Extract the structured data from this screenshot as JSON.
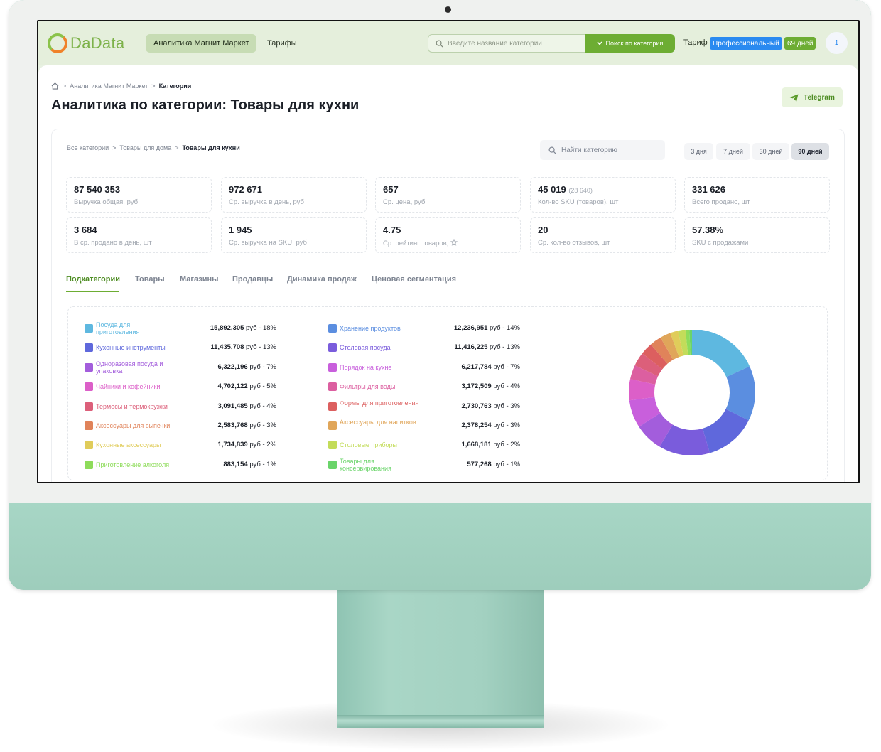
{
  "header": {
    "logo_text": "DaData",
    "nav_active": "Аналитика Магнит Маркет",
    "nav_link": "Тарифы",
    "search_placeholder": "Введите название категории",
    "search_button": "Поиск по категории",
    "tariff_label": "Тариф",
    "tariff_name": "Профессиональный",
    "tariff_days": "69 дней",
    "avatar": "1"
  },
  "breadcrumb": [
    "Аналитика Магнит Маркет",
    "Категории"
  ],
  "page_title": "Аналитика по категории: Товары для кухни",
  "telegram_button": "Telegram",
  "category_path": [
    "Все категории",
    "Товары для дома",
    "Товары для кухни"
  ],
  "find_placeholder": "Найти категорию",
  "periods": [
    "3 дня",
    "7 дней",
    "30 дней",
    "90 дней"
  ],
  "period_active": "90 дней",
  "stats": [
    {
      "value": "87 540 353",
      "extra": "",
      "label": "Выручка общая, руб"
    },
    {
      "value": "972 671",
      "extra": "",
      "label": "Ср. выручка в день, руб"
    },
    {
      "value": "657",
      "extra": "",
      "label": "Ср. цена, руб"
    },
    {
      "value": "45 019",
      "extra": "(28 640)",
      "label": "Кол-во SKU (товаров), шт"
    },
    {
      "value": "331 626",
      "extra": "",
      "label": "Всего продано, шт"
    },
    {
      "value": "3 684",
      "extra": "",
      "label": "В ср. продано в день, шт"
    },
    {
      "value": "1 945",
      "extra": "",
      "label": "Ср. выручка на SKU, руб"
    },
    {
      "value": "4.75",
      "extra": "",
      "label": "Ср. рейтинг товаров,"
    },
    {
      "value": "20",
      "extra": "",
      "label": "Ср. кол-во отзывов, шт"
    },
    {
      "value": "57.38%",
      "extra": "",
      "label": "SKU с продажами"
    }
  ],
  "tabs": [
    "Подкатегории",
    "Товары",
    "Магазины",
    "Продавцы",
    "Динамика продаж",
    "Ценовая сегментация"
  ],
  "tab_active": "Подкатегории",
  "chart_data": {
    "type": "pie",
    "unit": "руб",
    "slices": [
      {
        "name": "Посуда для приготовления",
        "value": 15892305,
        "percent": 18,
        "value_text": "15,892,305",
        "percent_text": "18%",
        "color": "#5eb8e0"
      },
      {
        "name": "Хранение продуктов",
        "value": 12236951,
        "percent": 14,
        "value_text": "12,236,951",
        "percent_text": "14%",
        "color": "#5b8ee0"
      },
      {
        "name": "Кухонные инструменты",
        "value": 11435708,
        "percent": 13,
        "value_text": "11,435,708",
        "percent_text": "13%",
        "color": "#5f68dc"
      },
      {
        "name": "Столовая посуда",
        "value": 11416225,
        "percent": 13,
        "value_text": "11,416,225",
        "percent_text": "13%",
        "color": "#7a5cdc"
      },
      {
        "name": "Одноразовая посуда и упаковка",
        "value": 6322196,
        "percent": 7,
        "value_text": "6,322,196",
        "percent_text": "7%",
        "color": "#a35ddc"
      },
      {
        "name": "Порядок на кухне",
        "value": 6217784,
        "percent": 7,
        "value_text": "6,217,784",
        "percent_text": "7%",
        "color": "#c85fdc"
      },
      {
        "name": "Чайники и кофейники",
        "value": 4702122,
        "percent": 5,
        "value_text": "4,702,122",
        "percent_text": "5%",
        "color": "#dc5fc8"
      },
      {
        "name": "Фильтры для воды",
        "value": 3172509,
        "percent": 4,
        "value_text": "3,172,509",
        "percent_text": "4%",
        "color": "#dc5fa0"
      },
      {
        "name": "Термосы и термокружки",
        "value": 3091485,
        "percent": 4,
        "value_text": "3,091,485",
        "percent_text": "4%",
        "color": "#dc5f7a"
      },
      {
        "name": "Формы для приготовления",
        "value": 2730763,
        "percent": 3,
        "value_text": "2,730,763",
        "percent_text": "3%",
        "color": "#dc5f5f"
      },
      {
        "name": "Аксессуары для выпечки",
        "value": 2583768,
        "percent": 3,
        "value_text": "2,583,768",
        "percent_text": "3%",
        "color": "#e0835a"
      },
      {
        "name": "Аксессуары для напитков",
        "value": 2378254,
        "percent": 3,
        "value_text": "2,378,254",
        "percent_text": "3%",
        "color": "#e0a65a"
      },
      {
        "name": "Кухонные аксессуары",
        "value": 1734839,
        "percent": 2,
        "value_text": "1,734,839",
        "percent_text": "2%",
        "color": "#e0cc5a"
      },
      {
        "name": "Столовые приборы",
        "value": 1668181,
        "percent": 2,
        "value_text": "1,668,181",
        "percent_text": "2%",
        "color": "#c3dc5a"
      },
      {
        "name": "Приготовление алкоголя",
        "value": 883154,
        "percent": 1,
        "value_text": "883,154",
        "percent_text": "1%",
        "color": "#8edc5a"
      },
      {
        "name": "Товары для консервирования",
        "value": 577268,
        "percent": 1,
        "value_text": "577,268",
        "percent_text": "1%",
        "color": "#6ad46a"
      }
    ]
  }
}
